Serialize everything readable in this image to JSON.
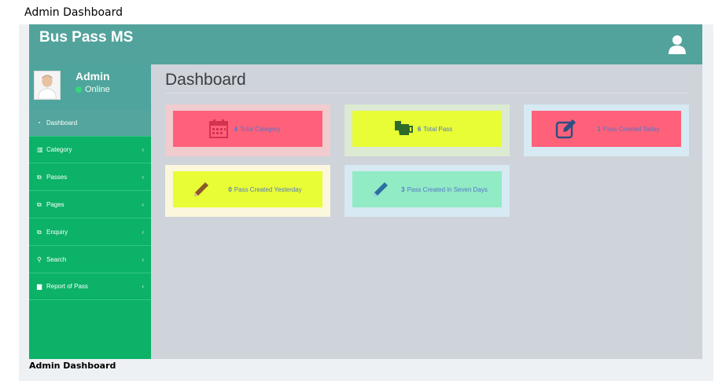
{
  "page_caption": "Admin Dashboard",
  "footer_caption": "Admin Dashboard",
  "brand": "Bus Pass MS",
  "profile": {
    "name": "Admin",
    "status": "Online"
  },
  "sidebar": {
    "items": [
      {
        "label": "Dashboard",
        "icon": "dashboard-icon",
        "active": true,
        "has_chevron": false
      },
      {
        "label": "Category",
        "icon": "bar-chart-icon",
        "active": false,
        "has_chevron": true
      },
      {
        "label": "Passes",
        "icon": "copy-icon",
        "active": false,
        "has_chevron": true
      },
      {
        "label": "Pages",
        "icon": "copy-icon",
        "active": false,
        "has_chevron": true
      },
      {
        "label": "Enquiry",
        "icon": "copy-icon",
        "active": false,
        "has_chevron": true
      },
      {
        "label": "Search",
        "icon": "search-icon",
        "active": false,
        "has_chevron": true
      },
      {
        "label": "Report of Pass",
        "icon": "folder-icon",
        "active": false,
        "has_chevron": true
      }
    ]
  },
  "main": {
    "title": "Dashboard",
    "cards": [
      {
        "count": "4",
        "label": "Total Category",
        "icon": "calendar-icon",
        "outer": "#f0cccf",
        "inner": "#fe6179",
        "icon_color": "#d5324f"
      },
      {
        "count": "6",
        "label": "Total Pass",
        "icon": "mug-icon",
        "outer": "#dcead3",
        "inner": "#e8fd35",
        "icon_color": "#2e6b2a"
      },
      {
        "count": "1",
        "label": "Pass Created Today",
        "icon": "edit-icon",
        "outer": "#d7eaf3",
        "inner": "#fe6179",
        "icon_color": "#2d4f84"
      },
      {
        "count": "0",
        "label": "Pass Created Yesterday",
        "icon": "pencil-icon",
        "outer": "#faf7dc",
        "inner": "#e8fd35",
        "icon_color": "#8a5a2a"
      },
      {
        "count": "3",
        "label": "Pass Created in Seven Days",
        "icon": "pencil-icon",
        "outer": "#d7eaf3",
        "inner": "#91ebc5",
        "icon_color": "#2d6ea2"
      }
    ]
  }
}
